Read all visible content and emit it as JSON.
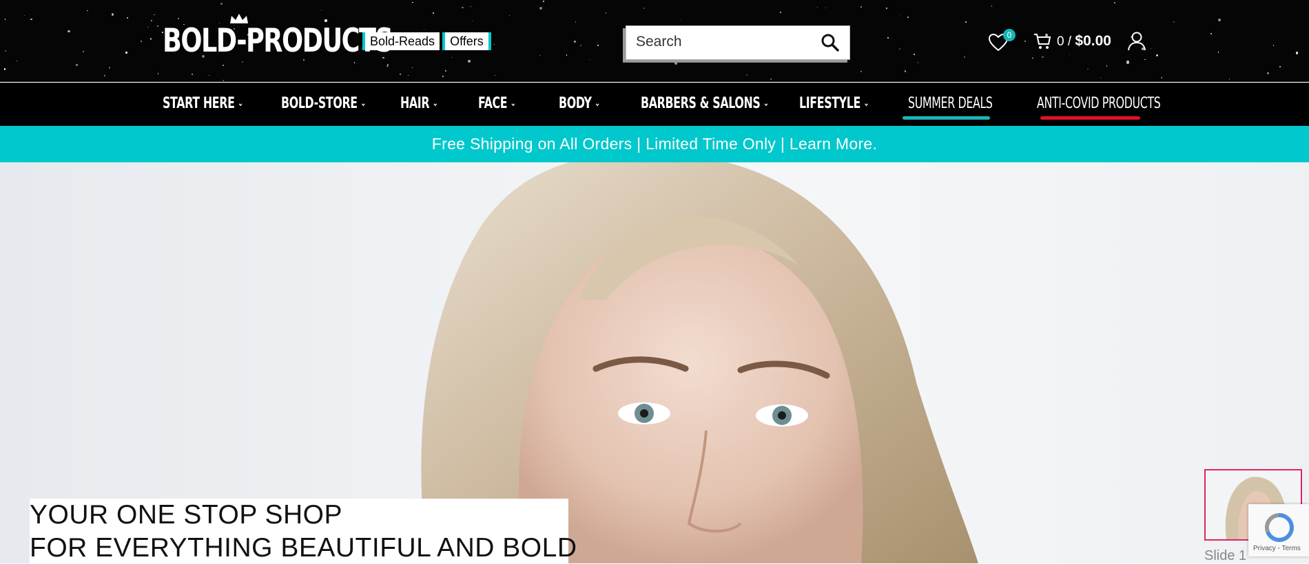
{
  "header": {
    "logo_text": "BOLD-PRODUCTS",
    "pills": [
      "Bold-Reads",
      "Offers"
    ],
    "search_placeholder": "Search",
    "wishlist_count": "0",
    "cart_count": "0 /",
    "cart_total": "$0.00"
  },
  "nav": {
    "items": [
      {
        "label": "START HERE"
      },
      {
        "label": "BOLD-STORE"
      },
      {
        "label": "HAIR"
      },
      {
        "label": "FACE"
      },
      {
        "label": "BODY"
      },
      {
        "label": "BARBERS & SALONS"
      },
      {
        "label": "LIFESTYLE"
      },
      {
        "label": "SUMMER DEALS"
      },
      {
        "label": "ANTI-COVID PRODUCTS"
      }
    ],
    "chevron": "⌄"
  },
  "banner": {
    "text": "Free Shipping on All Orders | Limited Time Only | Learn More."
  },
  "hero": {
    "line1": "YOUR ONE STOP SHOP",
    "line2": "FOR EVERYTHING BEAUTIFUL AND BOLD"
  },
  "slider": {
    "alt_text": "Slide 1"
  },
  "recaptcha": {
    "links": "Privacy - Terms"
  },
  "colors": {
    "accent": "#00c8cc",
    "covid_underline": "#e0102a",
    "badge": "#19b6b6"
  }
}
